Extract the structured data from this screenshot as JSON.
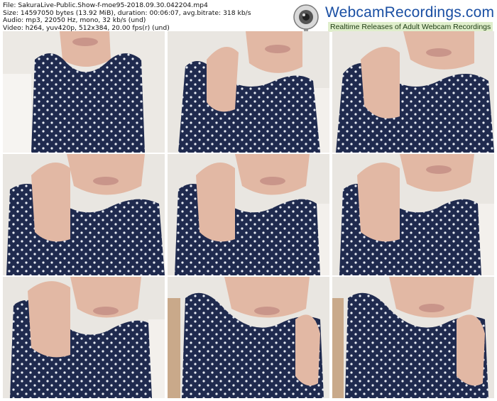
{
  "meta": {
    "file": "File: SakuraLive-Public.Show-f-moe95-2018.09.30.042204.mp4",
    "size": "Size: 14597050 bytes (13.92 MiB), duration: 00:06:07, avg.bitrate: 318 kb/s",
    "audio": "Audio: mp3, 22050 Hz, mono, 32 kb/s (und)",
    "video": "Video: h264, yuv420p, 512x384, 20.00 fps(r) (und)"
  },
  "brand": {
    "name": "WebcamRecordings.com",
    "tagline": "Realtime Releases of Adult Webcam Recordings",
    "icon": "webcam-icon",
    "colors": {
      "name": "#1a4fa3",
      "tagline_bg": "#dfeecb"
    }
  },
  "thumbnails": {
    "count": 9,
    "columns": 3,
    "rows": 3,
    "colors": {
      "shirt": "#1f2a4e",
      "dots": "#e8ecf4",
      "skin": "#e2b8a4",
      "background": "#e9e6e1"
    }
  }
}
